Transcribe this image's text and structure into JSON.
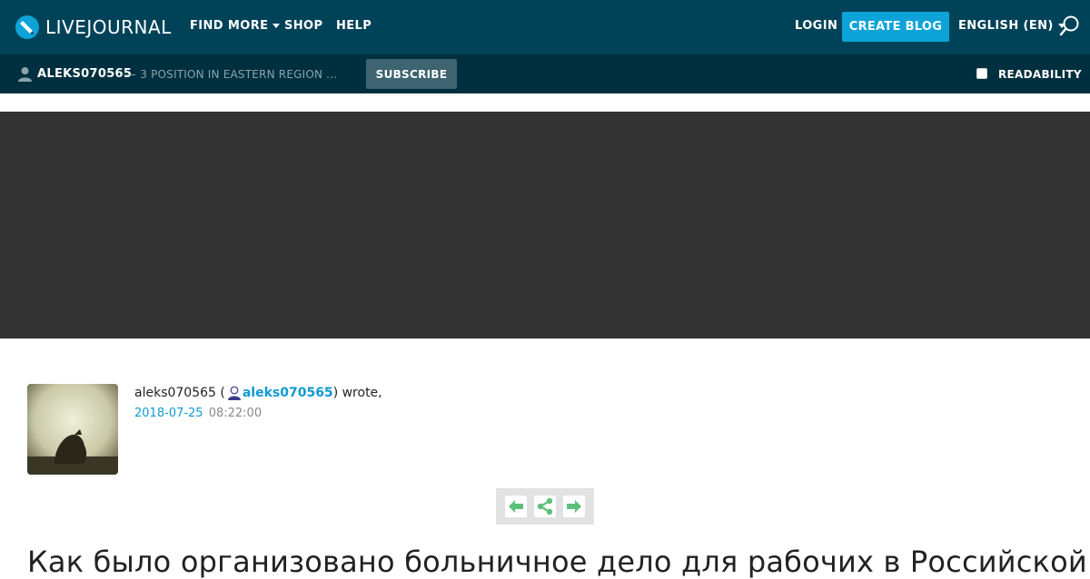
{
  "header": {
    "logo_text": "LIVEJOURNAL",
    "nav": [
      {
        "label": "FIND MORE",
        "has_dropdown": true
      },
      {
        "label": "SHOP"
      },
      {
        "label": "HELP"
      }
    ],
    "login_label": "LOGIN",
    "create_blog_label": "CREATE BLOG",
    "language_label": "ENGLISH (EN)"
  },
  "journal_bar": {
    "username": "ALEKS070565",
    "title": "— 3 POSITION IN EASTERN REGION ...",
    "subscribe_label": "SUBSCRIBE",
    "readability_label": "READABILITY",
    "readability_checked": false
  },
  "post": {
    "author_name": "aleks070565 (",
    "author_user": "aleks070565",
    "wrote_suffix": ") wrote,",
    "date": "2018-07-25",
    "time": "08:22:00",
    "title": "Как было организовано больничное дело для рабочих в Российской"
  },
  "colors": {
    "topbar": "#004359",
    "subbar": "#00303f",
    "accent": "#0da3d8",
    "banner": "#333333",
    "nav_arrows": "#5cc07a"
  },
  "icons": {
    "logo": "livejournal-logo-icon",
    "search": "search-icon",
    "user": "user-icon",
    "prev": "arrow-left-icon",
    "share": "share-icon",
    "next": "arrow-right-icon"
  }
}
